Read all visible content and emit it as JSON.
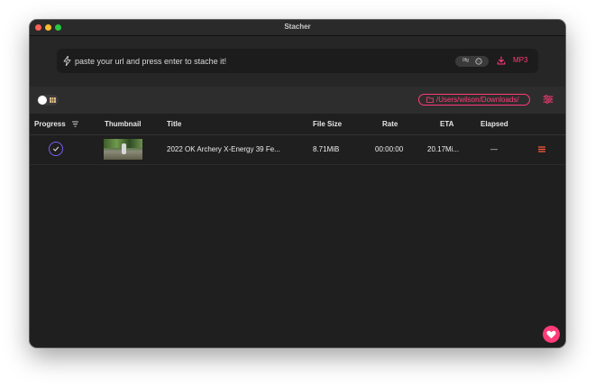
{
  "window": {
    "title": "Stacher"
  },
  "url_bar": {
    "placeholder": "paste your url and press enter to stache it!",
    "value": "",
    "cookie_label": "0fg",
    "format_label": "MP3"
  },
  "toolbar": {
    "download_path": "/Users/wilson/Downloads/"
  },
  "table": {
    "columns": [
      "Progress",
      "Thumbnail",
      "Title",
      "File Size",
      "Rate",
      "ETA",
      "Elapsed"
    ],
    "rows": [
      {
        "progress": "complete",
        "title": "2022 OK Archery X-Energy 39 Fe...",
        "file_size": "8.71MiB",
        "rate": "00:00:00",
        "eta": "20.17Mi...",
        "elapsed": "—"
      }
    ]
  },
  "colors": {
    "accent": "#ff3b78",
    "progress_ring": "#7a5cf5",
    "window_bg": "#1f1f1f"
  },
  "icons": [
    "bolt-icon",
    "cookie-icon",
    "download-icon",
    "grid-icon",
    "folder-icon",
    "settings-icon",
    "filter-icon",
    "check-icon",
    "menu-icon",
    "heart-icon"
  ]
}
